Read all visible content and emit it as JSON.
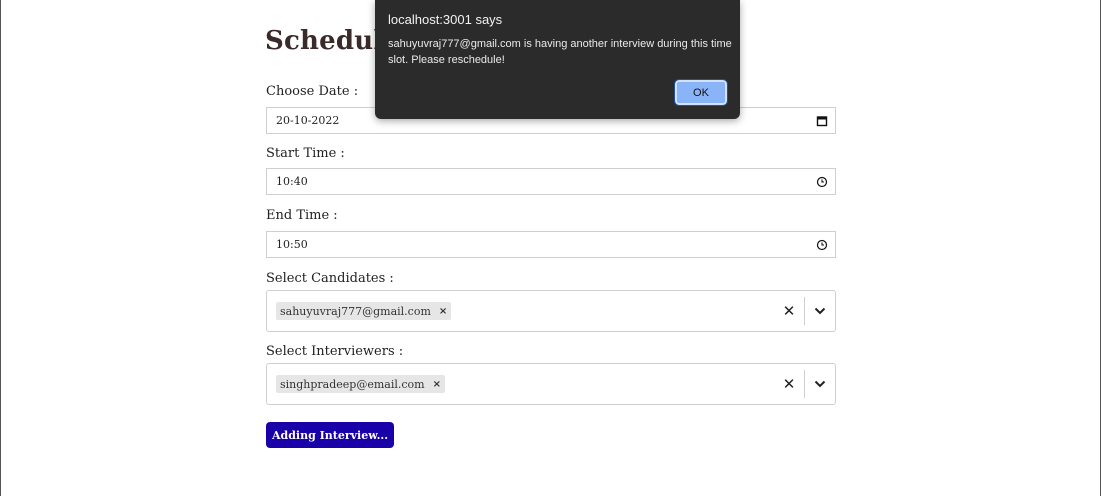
{
  "page": {
    "title": "Schedule :",
    "submit_label": "Adding Interview..."
  },
  "form": {
    "date": {
      "label": "Choose Date :",
      "value": "20-10-2022"
    },
    "start": {
      "label": "Start Time :",
      "value": "10:40"
    },
    "end": {
      "label": "End Time :",
      "value": "10:50"
    },
    "candidates": {
      "label": "Select Candidates :",
      "selected": [
        "sahuyuvraj777@gmail.com"
      ]
    },
    "interviewers": {
      "label": "Select Interviewers :",
      "selected": [
        "singhpradeep@email.com"
      ]
    },
    "remove_glyph": "×",
    "clear_glyph": "✕"
  },
  "dialog": {
    "title": "localhost:3001 says",
    "message": "sahuyuvraj777@gmail.com is having another interview during this time slot. Please reschedule!",
    "ok_label": "OK"
  },
  "colors": {
    "button_bg": "#1a00a8",
    "dialog_bg": "#2b2b2b",
    "ok_bg": "#8ab4f8"
  }
}
